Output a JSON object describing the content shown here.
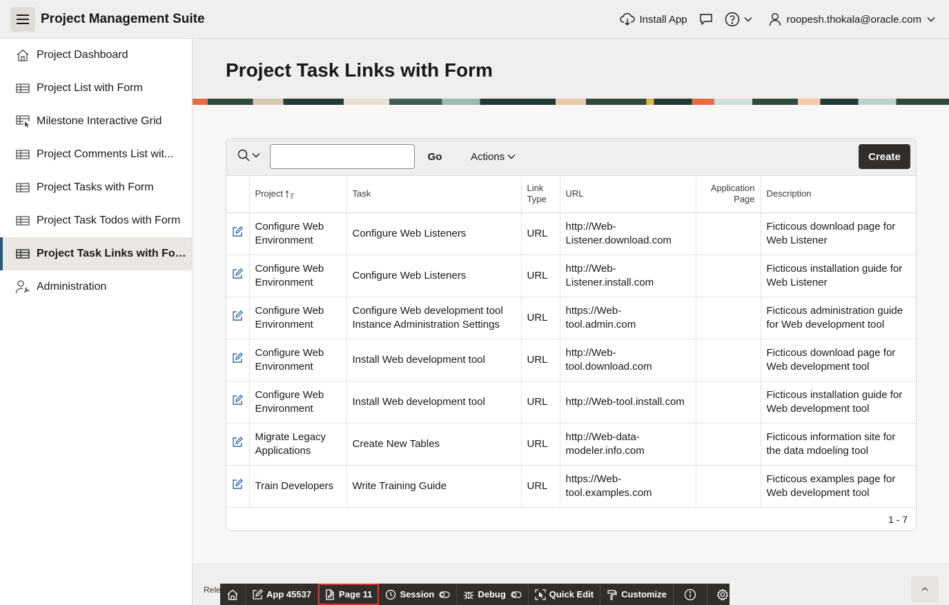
{
  "header": {
    "app_title": "Project Management Suite",
    "install_label": "Install App",
    "user_name": "roopesh.thokala@oracle.com"
  },
  "sidebar": {
    "items": [
      {
        "label": "Project Dashboard",
        "icon": "home-icon"
      },
      {
        "label": "Project List with Form",
        "icon": "table-icon"
      },
      {
        "label": "Milestone Interactive Grid",
        "icon": "interactive-grid-icon"
      },
      {
        "label": "Project Comments List wit...",
        "icon": "table-icon"
      },
      {
        "label": "Project Tasks with Form",
        "icon": "table-icon"
      },
      {
        "label": "Project Task Todos with Form",
        "icon": "table-icon"
      },
      {
        "label": "Project Task Links with Form",
        "icon": "table-icon",
        "active": true
      },
      {
        "label": "Administration",
        "icon": "user-wrench-icon"
      }
    ]
  },
  "page": {
    "title": "Project Task Links with Form"
  },
  "report": {
    "go_label": "Go",
    "actions_label": "Actions",
    "create_label": "Create",
    "search_value": "",
    "columns": [
      "Project",
      "Task",
      "Link Type",
      "URL",
      "Application Page",
      "Description"
    ],
    "rows": [
      {
        "project": "Configure Web Environment",
        "task": "Configure Web Listeners",
        "link_type": "URL",
        "url": "http://Web-Listener.download.com",
        "app_page": "",
        "description": "Ficticous download page for Web Listener"
      },
      {
        "project": "Configure Web Environment",
        "task": "Configure Web Listeners",
        "link_type": "URL",
        "url": "http://Web-Listener.install.com",
        "app_page": "",
        "description": "Ficticous installation guide for Web Listener"
      },
      {
        "project": "Configure Web Environment",
        "task": "Configure Web development tool Instance Administration Settings",
        "link_type": "URL",
        "url": "https://Web-tool.admin.com",
        "app_page": "",
        "description": "Ficticous administration guide for Web development tool"
      },
      {
        "project": "Configure Web Environment",
        "task": "Install Web development tool",
        "link_type": "URL",
        "url": "http://Web-tool.download.com",
        "app_page": "",
        "description": "Ficticous download page for Web development tool"
      },
      {
        "project": "Configure Web Environment",
        "task": "Install Web development tool",
        "link_type": "URL",
        "url": "http://Web-tool.install.com",
        "app_page": "",
        "description": "Ficticous installation guide for Web development tool"
      },
      {
        "project": "Migrate Legacy Applications",
        "task": "Create New Tables",
        "link_type": "URL",
        "url": "http://Web-data-modeler.info.com",
        "app_page": "",
        "description": "Ficticous information site for the data mdoeling tool"
      },
      {
        "project": "Train Developers",
        "task": "Write Training Guide",
        "link_type": "URL",
        "url": "https://Web-tool.examples.com",
        "app_page": "",
        "description": "Ficticous examples page for Web development tool"
      }
    ],
    "pagination": "1 - 7"
  },
  "footer": {
    "release_text": "Rele"
  },
  "devbar": {
    "items": [
      {
        "label": "",
        "icon": "home-icon"
      },
      {
        "label": "App 45537",
        "icon": "edit-icon"
      },
      {
        "label": "Page 11",
        "icon": "page-edit-icon",
        "highlighted": true
      },
      {
        "label": "Session",
        "icon": "session-icon",
        "toggle": true
      },
      {
        "label": "Debug",
        "icon": "bug-icon",
        "toggle": true
      },
      {
        "label": "Quick Edit",
        "icon": "quick-edit-icon"
      },
      {
        "label": "Customize",
        "icon": "customize-icon"
      },
      {
        "label": "",
        "icon": "info-icon"
      },
      {
        "label": "",
        "icon": "gear-icon"
      }
    ]
  },
  "colors": {
    "primary_button": "#312d2a",
    "active_nav_accent": "#2c5877",
    "edit_icon": "#2c6aa5",
    "highlight_outline": "#e0352b"
  }
}
